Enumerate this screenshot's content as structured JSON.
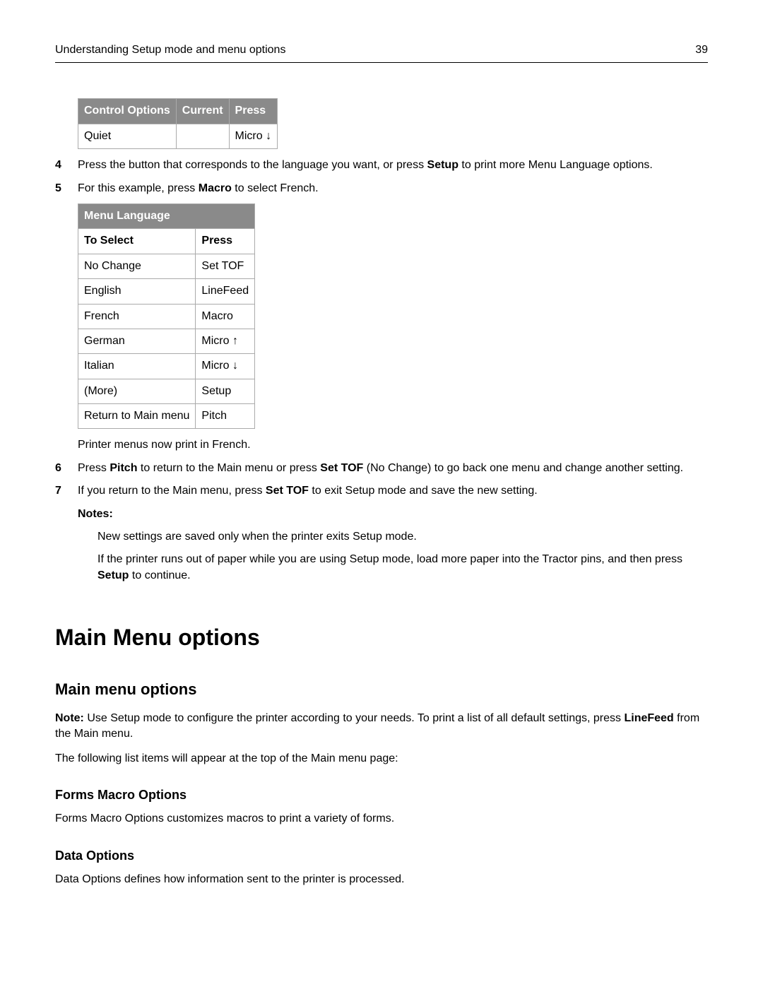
{
  "header": {
    "title": "Understanding Setup mode and menu options",
    "page_number": "39"
  },
  "table1": {
    "headers": [
      "Control Options",
      "Current",
      "Press"
    ],
    "rows": [
      {
        "c0": "Quiet",
        "c1": "",
        "c2_prefix": "Micro ",
        "c2_arrow": "↓"
      }
    ]
  },
  "step4": {
    "num": "4",
    "t1": "Press the button that corresponds to the language you want, or press ",
    "b1": "Setup",
    "t2": " to print more Menu Language options."
  },
  "step5": {
    "num": "5",
    "t1": "For this example, press ",
    "b1": "Macro",
    "t2": " to select French."
  },
  "table2": {
    "title": "Menu Language",
    "subhead": [
      "To Select",
      "Press"
    ],
    "rows": [
      {
        "c0": "No Change",
        "c1": "Set TOF"
      },
      {
        "c0": "English",
        "c1": "LineFeed"
      },
      {
        "c0": "French",
        "c1": "Macro"
      },
      {
        "c0": "German",
        "c1_prefix": "Micro ",
        "c1_arrow": "↑"
      },
      {
        "c0": "Italian",
        "c1_prefix": "Micro ",
        "c1_arrow": "↓"
      },
      {
        "c0": "(More)",
        "c1": "Setup"
      },
      {
        "c0": "Return to Main menu",
        "c1": "Pitch"
      }
    ]
  },
  "after_table2": "Printer menus now print in French.",
  "step6": {
    "num": "6",
    "t1": "Press ",
    "b1": "Pitch",
    "t2": " to return to the Main menu or press ",
    "b2": "Set TOF",
    "t3": " (No Change) to go back one menu and change another setting."
  },
  "step7": {
    "num": "7",
    "t1": "If you return to the Main menu, press ",
    "b1": "Set TOF",
    "t2": " to exit Setup mode and save the new setting."
  },
  "notes": {
    "label": "Notes:",
    "n1": "New settings are saved only when the printer exits Setup mode.",
    "n2_t1": "If the printer runs out of paper while you are using Setup mode, load more paper into the Tractor pins, and then press ",
    "n2_b1": "Setup",
    "n2_t2": " to continue."
  },
  "h1": "Main Menu options",
  "h2": "Main menu options",
  "note_para": {
    "b0": "Note:",
    "t1": " Use Setup mode to configure the printer according to your needs. To print a list of all default settings, press ",
    "b1": "LineFeed",
    "t2": " from the Main menu."
  },
  "list_intro": "The following list items will appear at the top of the Main menu page:",
  "forms": {
    "title": "Forms Macro Options",
    "body": "Forms Macro Options customizes macros to print a variety of forms."
  },
  "data_opts": {
    "title": "Data Options",
    "body": "Data Options defines how information sent to the printer is processed."
  }
}
